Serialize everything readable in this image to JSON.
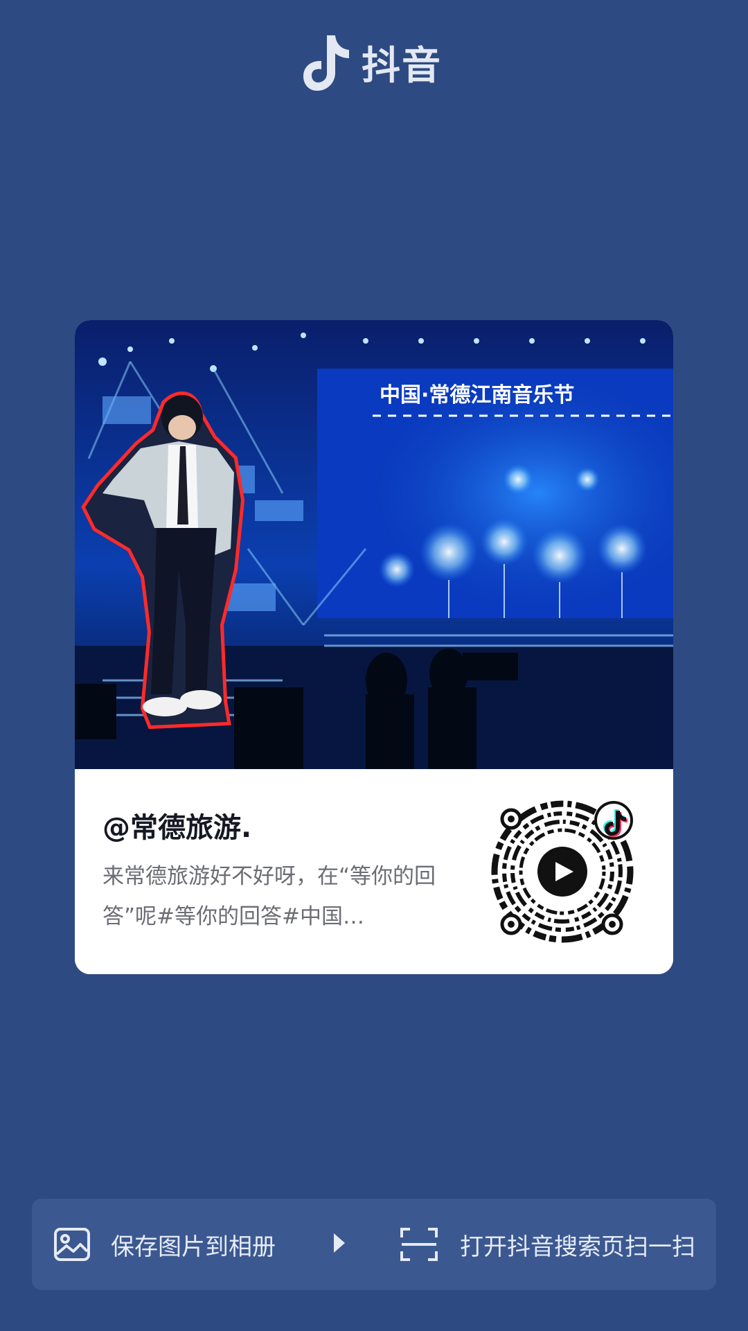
{
  "app": {
    "name": "抖音",
    "logo_icon": "tiktok-note-icon",
    "background": "#2e4a82"
  },
  "card": {
    "image": {
      "stage_banner": "中国·常德江南音乐节",
      "subject": "performer-on-stage"
    },
    "author": "@常德旅游.",
    "description": "来常德旅游好不好呀，在“等你的回答”呢#等你的回答#中国…",
    "qr_icon": "douyin-qr-code",
    "play_icon": "play-icon"
  },
  "actions": {
    "save": {
      "label": "保存图片到相册",
      "icon": "image-icon"
    },
    "scan": {
      "label": "打开抖音搜索页扫一扫",
      "icon": "scan-icon"
    },
    "divider_icon": "triangle-right-icon"
  },
  "colors": {
    "accent_cyan": "#25f4ee",
    "accent_red": "#fe2c55",
    "card_bg": "#ffffff",
    "bar_bg": "#3b5891"
  }
}
